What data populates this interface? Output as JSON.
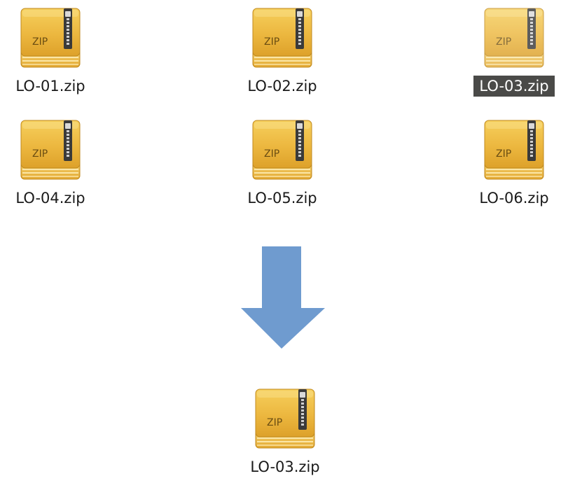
{
  "files": [
    {
      "name": "LO-01.zip",
      "icon": "zip-archive-icon",
      "selected": false
    },
    {
      "name": "LO-02.zip",
      "icon": "zip-archive-icon",
      "selected": false
    },
    {
      "name": "LO-03.zip",
      "icon": "zip-archive-icon",
      "selected": true
    },
    {
      "name": "LO-04.zip",
      "icon": "zip-archive-icon",
      "selected": false
    },
    {
      "name": "LO-05.zip",
      "icon": "zip-archive-icon",
      "selected": false
    },
    {
      "name": "LO-06.zip",
      "icon": "zip-archive-icon",
      "selected": false
    }
  ],
  "result": {
    "name": "LO-03.zip",
    "icon": "zip-archive-icon"
  },
  "icon_text": "ZIP",
  "arrow": {
    "icon": "down-arrow-icon",
    "color": "#6f9bcf"
  },
  "colors": {
    "zip_gold": "#e8b53d",
    "selection_bg": "#4a4a48",
    "selection_text": "#ffffff"
  }
}
